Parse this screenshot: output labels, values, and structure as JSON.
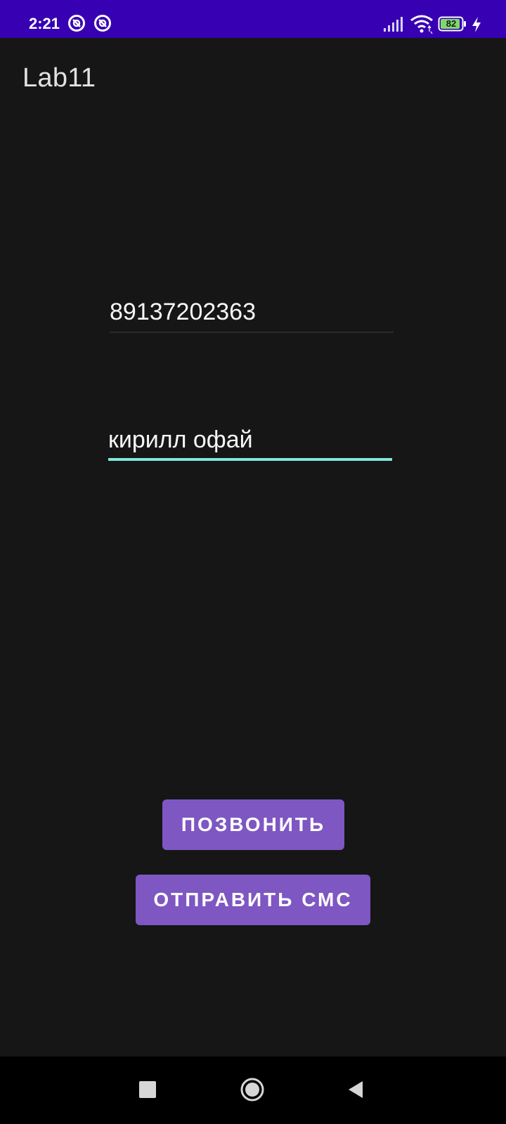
{
  "status_bar": {
    "time": "2:21",
    "notification_icons": [
      "app-notification-icon",
      "app-notification-icon"
    ],
    "signal_icon": "cell-signal-icon",
    "wifi_icon": "wifi-icon",
    "battery_level": "82",
    "charging_icon": "charging-bolt-icon",
    "background_color": "#3700b3"
  },
  "app_bar": {
    "title": "Lab11"
  },
  "form": {
    "phone_value": "89137202363",
    "message_value": "кирилл офай",
    "accent_color": "#7fe9da"
  },
  "buttons": {
    "call_label": "ПОЗВОНИТЬ",
    "sms_label": "ОТПРАВИТЬ СМС",
    "button_color": "#7e57c2"
  },
  "nav_bar": {
    "recents_icon": "square-recents-icon",
    "home_icon": "circle-home-icon",
    "back_icon": "triangle-back-icon"
  }
}
